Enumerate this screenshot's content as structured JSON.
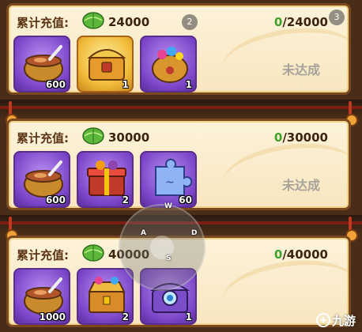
{
  "badges": [
    "2",
    "3"
  ],
  "tiers": [
    {
      "label": "累计充值:",
      "amount": "24000",
      "progress_current": "0",
      "progress_total": "/24000",
      "status": "未达成",
      "items": [
        {
          "icon": "soup-pot-icon",
          "qty": "600",
          "bg": "purple"
        },
        {
          "icon": "treasure-chest-icon",
          "qty": "1",
          "bg": "gold"
        },
        {
          "icon": "lucky-bag-icon",
          "qty": "1",
          "bg": "purple"
        }
      ]
    },
    {
      "label": "累计充值:",
      "amount": "30000",
      "progress_current": "0",
      "progress_total": "/30000",
      "status": "未达成",
      "items": [
        {
          "icon": "soup-pot-icon",
          "qty": "600",
          "bg": "purple"
        },
        {
          "icon": "gift-chest-icon",
          "qty": "2",
          "bg": "purple"
        },
        {
          "icon": "puzzle-piece-icon",
          "qty": "60",
          "bg": "purple"
        }
      ]
    },
    {
      "label": "累计充值:",
      "amount": "40000",
      "progress_current": "0",
      "progress_total": "/40000",
      "status": "",
      "items": [
        {
          "icon": "soup-pot-icon",
          "qty": "1000",
          "bg": "purple"
        },
        {
          "icon": "jewel-chest-icon",
          "qty": "2",
          "bg": "purple"
        },
        {
          "icon": "crystal-chest-icon",
          "qty": "1",
          "bg": "purple"
        }
      ]
    }
  ],
  "joystick": {
    "keys": [
      "A",
      "D",
      "S",
      "W"
    ]
  },
  "watermark": "九游",
  "colors": {
    "progress_current": "#3fa12a",
    "status": "#a8a39a",
    "panel": "#fdf3da"
  }
}
